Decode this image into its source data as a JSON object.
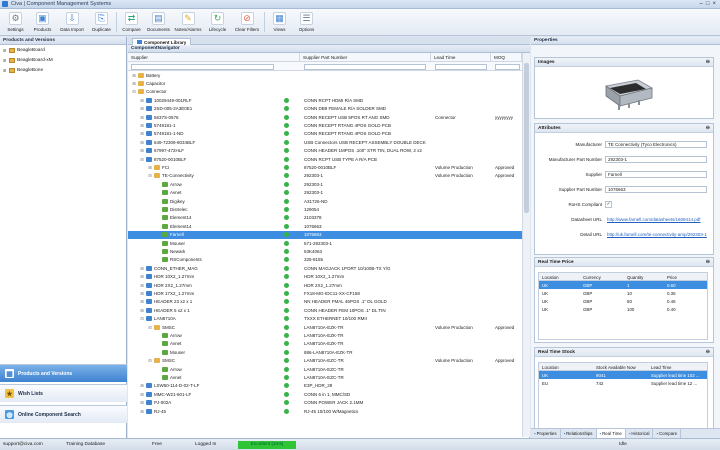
{
  "window": {
    "title": "Civa | Component Management Systems"
  },
  "toolbar": [
    {
      "label": "Settings",
      "icon": "settings-icon"
    },
    {
      "label": "Products",
      "icon": "products-icon"
    },
    {
      "label": "Data Import",
      "icon": "data-import-icon"
    },
    {
      "label": "Duplicate",
      "icon": "duplicate-icon"
    },
    {
      "label": "Compare",
      "icon": "compare-icon"
    },
    {
      "label": "Documents",
      "icon": "documents-icon"
    },
    {
      "label": "Notes/Alarms",
      "icon": "notes-alarms-icon"
    },
    {
      "label": "Lifecycle",
      "icon": "lifecycle-icon"
    },
    {
      "label": "Clear Filters",
      "icon": "clear-filters-icon"
    },
    {
      "label": "Views",
      "icon": "views-icon"
    },
    {
      "label": "Options",
      "icon": "options-icon"
    }
  ],
  "left_panel": {
    "header": "Products and Versions",
    "items": [
      "BeagleBoard",
      "BeagleBoard-xM",
      "BeagleBone"
    ],
    "nav": [
      "Products and Versions",
      "Wish Lists",
      "Online Component Search"
    ]
  },
  "center": {
    "tab": "Component Library",
    "header": "ComponentNavigator",
    "columns": [
      "Supplier",
      "Supplier Part Number",
      "Lead Time",
      "MOQ"
    ],
    "rows": [
      {
        "level": 0,
        "name": "Battery",
        "type": "cat",
        "exp": "+"
      },
      {
        "level": 0,
        "name": "Capacitor",
        "type": "cat",
        "exp": "+"
      },
      {
        "level": 0,
        "name": "Connector",
        "type": "cat",
        "exp": "−"
      },
      {
        "level": 1,
        "name": "10029449-001RLF",
        "type": "part",
        "exp": "+",
        "check": true,
        "spn": "CONN RCPT HDMI R/A SMD"
      },
      {
        "level": 1,
        "name": "2SD-005-2A3E0E1",
        "type": "part",
        "exp": "+",
        "check": true,
        "spn": "CONN DB9 FEMALE R/A SOLDER SMD"
      },
      {
        "level": 1,
        "name": "5637S-0576",
        "type": "part",
        "exp": "+",
        "check": true,
        "spn": "CONN RECEPT USB 5POS RT ANG SMD",
        "lt": "Connector",
        "moq": "yyyyyyyy"
      },
      {
        "level": 1,
        "name": "5749181-1",
        "type": "part",
        "exp": "+",
        "check": true,
        "spn": "CONN RECEPT RTANG 4POS GOLD PCB"
      },
      {
        "level": 1,
        "name": "5749181-1-ND",
        "type": "part",
        "exp": "+",
        "check": true,
        "spn": "CONN RECEPT RTANG 4POS GOLD PCB"
      },
      {
        "level": 1,
        "name": "649-72309-8034BLF",
        "type": "part",
        "exp": "+",
        "check": true,
        "spn": "USB Connectors USB RECEPT ASSEMBLY DOUBLE DECK"
      },
      {
        "level": 1,
        "name": "67997-472HLF",
        "type": "part",
        "exp": "+",
        "check": true,
        "spn": "CONN HEADER 1MPOS .100\" STR TIN, DUAL ROW, 2 x2"
      },
      {
        "level": 1,
        "name": "87520-0010BLF",
        "type": "part",
        "exp": "−",
        "check": true,
        "spn": "CONN RCPT USB TYPE A R/A PCB"
      },
      {
        "level": 2,
        "name": "FCI",
        "type": "folder",
        "exp": "+",
        "check": true,
        "spn": "87520-0010BLF",
        "lt": "Volume Production",
        "moq": "Approved"
      },
      {
        "level": 2,
        "name": "TE-Connectivity",
        "type": "folder",
        "exp": "−",
        "check": true,
        "spn": "292303-1",
        "lt": "Volume Production",
        "moq": "Approved"
      },
      {
        "level": 3,
        "name": "Arrow",
        "type": "sup",
        "check": true,
        "spn": "292303-1"
      },
      {
        "level": 3,
        "name": "Avnet",
        "type": "sup",
        "check": true,
        "spn": "292303-1"
      },
      {
        "level": 3,
        "name": "Digikey",
        "type": "sup",
        "check": true,
        "spn": "A31726-ND"
      },
      {
        "level": 3,
        "name": "Distrelec",
        "type": "sup",
        "check": true,
        "spn": "129054"
      },
      {
        "level": 3,
        "name": "Element14",
        "type": "sup",
        "check": true,
        "spn": "2103378"
      },
      {
        "level": 3,
        "name": "Element14",
        "type": "sup",
        "check": true,
        "spn": "1076663"
      },
      {
        "level": 3,
        "name": "Farnell",
        "type": "sup",
        "check": true,
        "spn": "1076663",
        "sel": true
      },
      {
        "level": 3,
        "name": "Mouser",
        "type": "sup",
        "check": true,
        "spn": "571-292303-1"
      },
      {
        "level": 3,
        "name": "Newark",
        "type": "sup",
        "check": true,
        "spn": "53K4063"
      },
      {
        "level": 3,
        "name": "RSComponents",
        "type": "sup",
        "check": true,
        "spn": "325-8155"
      },
      {
        "level": 1,
        "name": "CONN_ETHER_MAG",
        "type": "part",
        "exp": "+",
        "check": true,
        "spn": "CONN MAGJACK 1PORT 10/100B-TX Y/G"
      },
      {
        "level": 1,
        "name": "HDR 10X2_1.27mm",
        "type": "part",
        "exp": "+",
        "check": true,
        "spn": "HDR 10X2_1.27mm"
      },
      {
        "level": 1,
        "name": "HDR 2X2_1.27mm",
        "type": "part",
        "exp": "+",
        "check": true,
        "spn": "HDR 2X2_1.27mm"
      },
      {
        "level": 1,
        "name": "HDR 17X2_1.27mm",
        "type": "part",
        "exp": "+",
        "check": true,
        "spn": "FX18-MG-IDC11-XX-CF158"
      },
      {
        "level": 1,
        "name": "HEADER 23 x2 x 1",
        "type": "part",
        "exp": "+",
        "check": true,
        "spn": "NN HEADER FMAL 46POS .1\" DL GOLD"
      },
      {
        "level": 1,
        "name": "HEADER 5 x2 x 1",
        "type": "part",
        "exp": "+",
        "check": true,
        "spn": "CONN HEADER FEM 10POS .1\" DL TIN"
      },
      {
        "level": 1,
        "name": "LAN8710A",
        "type": "part",
        "exp": "−",
        "check": true,
        "spn": "TXXX ETHERNET 10/100 RMII"
      },
      {
        "level": 2,
        "name": "SMSC",
        "type": "folder",
        "exp": "−",
        "check": true,
        "spn": "LAN8710A-EZK-TR",
        "lt": "Volume Production",
        "moq": "Approved"
      },
      {
        "level": 3,
        "name": "Arrow",
        "type": "sup",
        "check": true,
        "spn": "LAN8710A-EZK-TR"
      },
      {
        "level": 3,
        "name": "Avnet",
        "type": "sup",
        "check": true,
        "spn": "LAN8710A-EZK-TR"
      },
      {
        "level": 3,
        "name": "Mouser",
        "type": "sup",
        "check": true,
        "spn": "886-LAN8710A-EZK-TR"
      },
      {
        "level": 2,
        "name": "SMSC",
        "type": "folder",
        "exp": "−",
        "check": true,
        "spn": "LAN8710A-EZC-TR",
        "lt": "Volume Production",
        "moq": "Approved"
      },
      {
        "level": 3,
        "name": "Arrow",
        "type": "sup",
        "check": true,
        "spn": "LAN8710A-EZC-TR"
      },
      {
        "level": 3,
        "name": "Avnet",
        "type": "sup",
        "check": true,
        "spn": "LAN8710A-EZC-TR"
      },
      {
        "level": 1,
        "name": "LSW50-114-D-02-T-LF",
        "type": "part",
        "exp": "+",
        "check": true,
        "spn": "E3P_HDR_28"
      },
      {
        "level": 1,
        "name": "MMC-W21-601-LF",
        "type": "part",
        "exp": "+",
        "check": true,
        "spn": "CONN 6 in 1, MMC/SD"
      },
      {
        "level": 1,
        "name": "PJ-002A",
        "type": "part",
        "exp": "+",
        "check": true,
        "spn": "CONN POWER JACK 2.1MM"
      },
      {
        "level": 1,
        "name": "RJ-45",
        "type": "part",
        "exp": "+",
        "check": true,
        "spn": "RJ-45 10/100 W/Magnetics"
      }
    ]
  },
  "right": {
    "header": "Properties",
    "images_title": "Images",
    "attributes_title": "Attributes",
    "attributes": [
      {
        "k": "Manufacturer",
        "v": "TE Connectivity (Tyco Electronics)"
      },
      {
        "k": "Manufacturer Part Number",
        "v": "292303-1"
      },
      {
        "k": "Supplier",
        "v": "Farnell"
      },
      {
        "k": "Supplier Part Number",
        "v": "1076663"
      },
      {
        "k": "RoHS Compliant",
        "v": "✓"
      },
      {
        "k": "Datasheet URL",
        "v": "http://www.farnell.com/datasheets/1609414.pdf",
        "link": true
      },
      {
        "k": "Detail URL",
        "v": "http://uk.farnell.com/te-connectivity-amp/292303-1",
        "link": true
      }
    ],
    "price_title": "Real Time Price",
    "price_cols": [
      "Location",
      "Currency",
      "Quantity",
      "Price"
    ],
    "price_rows": [
      [
        "UK",
        "GBP",
        "1",
        "0.60"
      ],
      [
        "UK",
        "GBP",
        "10",
        "0.36"
      ],
      [
        "UK",
        "GBP",
        "50",
        "0.46"
      ],
      [
        "UK",
        "GBP",
        "100",
        "0.40"
      ]
    ],
    "stock_title": "Real Time Stock",
    "stock_cols": [
      "Location",
      "Stock Available Now",
      "Lead Time"
    ],
    "stock_rows": [
      [
        "UK",
        "9041",
        "Supplier lead time 102 ..."
      ],
      [
        "EU",
        "742",
        "Supplier lead time 12 ..."
      ]
    ],
    "tabs": [
      "Properties",
      "Relationships",
      "Real Time",
      "Historical",
      "Compare"
    ]
  },
  "status": {
    "email": "support@civa.com",
    "db": "Training Database",
    "plan": "Free",
    "login": "Logged In",
    "conn": "Excellent [1ms]",
    "state": "Idle"
  }
}
